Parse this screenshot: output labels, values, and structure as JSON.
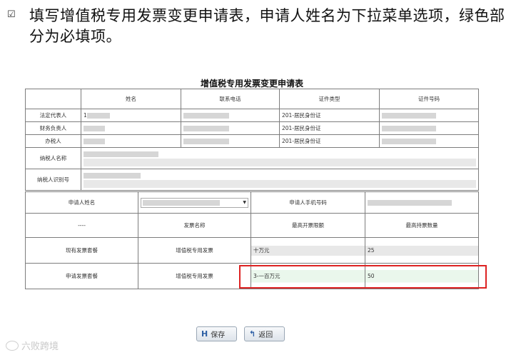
{
  "caption": {
    "text": "填写增值税专用发票变更申请表，申请人姓名为下拉菜单选项，绿色部分为必填项。"
  },
  "form": {
    "title": "增值税专用发票变更申请表",
    "headers": [
      "姓名",
      "联系电话",
      "证件类型",
      "证件号码"
    ],
    "rows": [
      {
        "label": "法定代表人",
        "name": "1",
        "id_type": "201-居民身份证"
      },
      {
        "label": "财务负责人",
        "name": "",
        "id_type": "201-居民身份证"
      },
      {
        "label": "办税人",
        "name": "",
        "id_type": "201-居民身份证"
      }
    ],
    "taxpayer_name_label": "纳税人名称",
    "taxpayer_id_label": "纳税人识别号"
  },
  "apply": {
    "applicant_label": "申请人姓名",
    "phone_label": "申请人手机号码",
    "dash": "----",
    "col_invoice": "发票名称",
    "col_limit": "最高开票限额",
    "col_qty": "最高持票数量",
    "current_label": "现有发票套餐",
    "current_invoice": "增值税专用发票",
    "current_limit": "十万元",
    "current_qty": "25",
    "request_label": "申请发票套餐",
    "request_invoice": "增值税专用发票",
    "request_limit": "3-一百万元",
    "request_qty": "50"
  },
  "buttons": {
    "save": "保存",
    "back": "返回"
  },
  "watermark": "六败跨境"
}
